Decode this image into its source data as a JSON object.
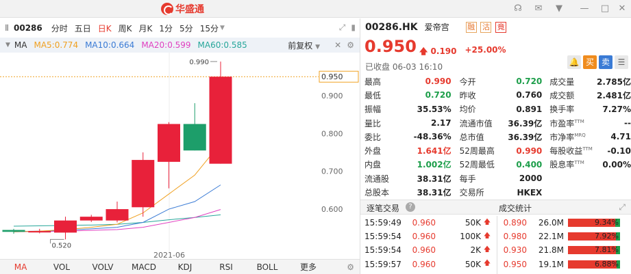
{
  "app": {
    "logo_text": "华盛通"
  },
  "chart_toolbar": {
    "code": "00286",
    "tabs": [
      "分时",
      "五日",
      "日K",
      "周K",
      "月K",
      "1分",
      "5分",
      "15分"
    ],
    "active_tab": "日K"
  },
  "ma_row": {
    "label": "MA",
    "ma5": "MA5:0.774",
    "ma10": "MA10:0.664",
    "ma20": "MA20:0.599",
    "ma60": "MA60:0.585",
    "adjust": "前复权",
    "colors": {
      "ma5": "#f0a020",
      "ma10": "#3a7bd5",
      "ma20": "#e040c0",
      "ma60": "#26a69a"
    }
  },
  "chart_data": {
    "type": "candlestick",
    "up_color": "#e8213a",
    "down_color": "#1d9e6a",
    "y_ticks": [
      0.9,
      0.8,
      0.7,
      0.6
    ],
    "y_tick_labels": [
      "0.900",
      "0.800",
      "0.700",
      "0.600"
    ],
    "ylim": [
      0.49,
      1.01
    ],
    "x_label": "2021-06",
    "last_price_label": "0.950",
    "high_annotation": "0.990",
    "low_annotation": "0.520",
    "candles": [
      {
        "open": 0.545,
        "close": 0.54,
        "high": 0.548,
        "low": 0.535
      },
      {
        "open": 0.54,
        "close": 0.542,
        "high": 0.548,
        "low": 0.536
      },
      {
        "open": 0.538,
        "close": 0.57,
        "high": 0.58,
        "low": 0.52
      },
      {
        "open": 0.57,
        "close": 0.58,
        "high": 0.585,
        "low": 0.566
      },
      {
        "open": 0.57,
        "close": 0.6,
        "high": 0.62,
        "low": 0.565
      },
      {
        "open": 0.605,
        "close": 0.73,
        "high": 0.75,
        "low": 0.58
      },
      {
        "open": 0.725,
        "close": 0.825,
        "high": 0.83,
        "low": 0.655
      },
      {
        "open": 0.825,
        "close": 0.755,
        "high": 0.88,
        "low": 0.755
      },
      {
        "open": 0.72,
        "close": 0.95,
        "high": 0.99,
        "low": 0.72
      }
    ],
    "ma_lines": {
      "ma5": [
        0.54,
        0.542,
        0.546,
        0.552,
        0.56,
        0.59,
        0.64,
        0.69,
        0.774
      ],
      "ma10": [
        0.541,
        0.542,
        0.544,
        0.548,
        0.552,
        0.565,
        0.6,
        0.62,
        0.664
      ],
      "ma20": [
        0.54,
        0.541,
        0.542,
        0.544,
        0.546,
        0.552,
        0.565,
        0.578,
        0.599
      ],
      "ma60": [
        0.555,
        0.556,
        0.557,
        0.558,
        0.56,
        0.565,
        0.572,
        0.578,
        0.585
      ]
    }
  },
  "indicators": {
    "items": [
      "MA",
      "VOL",
      "VOLV",
      "MACD",
      "KDJ",
      "RSI",
      "BOLL",
      "更多"
    ],
    "active": "MA"
  },
  "quote": {
    "symbol": "00286.HK",
    "name": "爱帝宫",
    "tags": [
      "融",
      "沽",
      "竟"
    ],
    "price": "0.950",
    "change": "0.190",
    "change_pct": "+25.00%",
    "close_info": "已收盘 06-03 16:10",
    "buttons": {
      "buy": "买",
      "sell": "卖"
    },
    "rows": [
      [
        {
          "k": "最高",
          "v": "0.990",
          "c": "red"
        },
        {
          "k": "今开",
          "v": "0.720",
          "c": "green"
        },
        {
          "k": "成交量",
          "v": "2.785亿",
          "c": "dark"
        }
      ],
      [
        {
          "k": "最低",
          "v": "0.720",
          "c": "green"
        },
        {
          "k": "昨收",
          "v": "0.760",
          "c": "dark"
        },
        {
          "k": "成交额",
          "v": "2.481亿",
          "c": "dark"
        }
      ],
      [
        {
          "k": "振幅",
          "v": "35.53%",
          "c": "dark"
        },
        {
          "k": "均价",
          "v": "0.891",
          "c": "dark"
        },
        {
          "k": "换手率",
          "v": "7.27%",
          "c": "dark"
        }
      ],
      [
        {
          "k": "量比",
          "v": "2.17",
          "c": "dark"
        },
        {
          "k": "流通市值",
          "v": "36.39亿",
          "c": "dark"
        },
        {
          "k": "市盈率",
          "sup": "TTM",
          "v": "--",
          "c": "dark"
        }
      ],
      [
        {
          "k": "委比",
          "v": "-48.36%",
          "c": "dark"
        },
        {
          "k": "总市值",
          "v": "36.39亿",
          "c": "dark"
        },
        {
          "k": "市净率",
          "sup": "MRQ",
          "v": "4.71",
          "c": "dark"
        }
      ],
      [
        {
          "k": "外盘",
          "v": "1.641亿",
          "c": "red"
        },
        {
          "k": "52周最高",
          "v": "0.990",
          "c": "red"
        },
        {
          "k": "每股收益",
          "sup": "TTM",
          "v": "-0.10",
          "c": "dark"
        }
      ],
      [
        {
          "k": "内盘",
          "v": "1.002亿",
          "c": "green"
        },
        {
          "k": "52周最低",
          "v": "0.400",
          "c": "green"
        },
        {
          "k": "股息率",
          "sup": "TTM",
          "v": "0.00%",
          "c": "dark"
        }
      ],
      [
        {
          "k": "流通股",
          "v": "38.31亿",
          "c": "dark"
        },
        {
          "k": "每手",
          "v": "2000",
          "c": "dark"
        },
        null
      ],
      [
        {
          "k": "总股本",
          "v": "38.31亿",
          "c": "dark"
        },
        {
          "k": "交易所",
          "v": "HKEX",
          "c": "dark"
        },
        null
      ]
    ]
  },
  "sections": {
    "ticks_title": "逐笔交易",
    "stats_title": "成交统计"
  },
  "ticks": [
    {
      "time": "15:59:49",
      "price": "0.960",
      "vol": "50K"
    },
    {
      "time": "15:59:54",
      "price": "0.960",
      "vol": "100K"
    },
    {
      "time": "15:59:54",
      "price": "0.960",
      "vol": "2K"
    },
    {
      "time": "15:59:57",
      "price": "0.960",
      "vol": "50K"
    }
  ],
  "stats": [
    {
      "price": "0.890",
      "vol": "26.0M",
      "buy_fraction": 0.9066,
      "pct": "9.34%"
    },
    {
      "price": "0.980",
      "vol": "22.1M",
      "buy_fraction": 0.9208,
      "pct": "7.92%"
    },
    {
      "price": "0.930",
      "vol": "21.8M",
      "buy_fraction": 0.9219,
      "pct": "7.81%"
    },
    {
      "price": "0.950",
      "vol": "19.1M",
      "buy_fraction": 0.9312,
      "pct": "6.88%"
    }
  ]
}
